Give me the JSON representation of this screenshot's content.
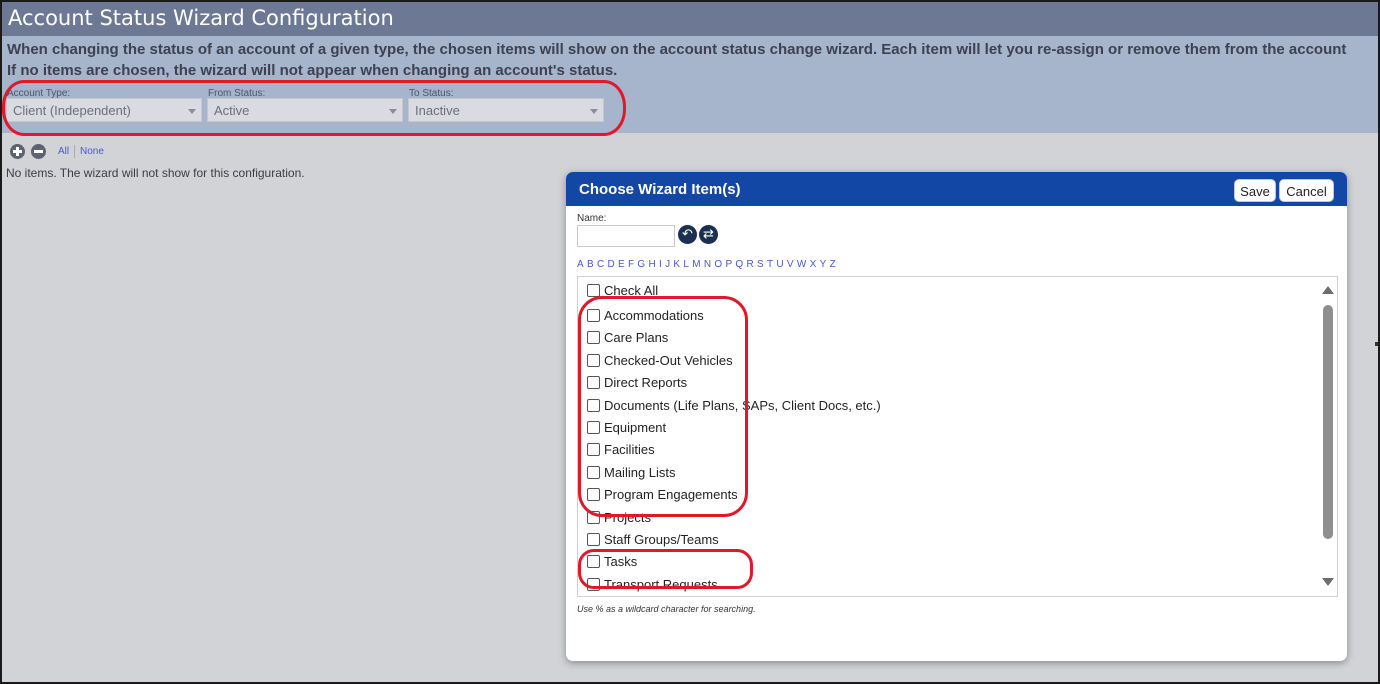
{
  "page": {
    "title": "Account Status Wizard Configuration",
    "description_line1": "When changing the status of an account of a given type, the chosen items will show on the account status change wizard. Each item will let you re-assign or remove them from the account",
    "description_line2": "If no items are chosen, the wizard will not appear when changing an account's status."
  },
  "filters": {
    "account_type": {
      "label": "Account Type:",
      "value": "Client (Independent)"
    },
    "from_status": {
      "label": "From Status:",
      "value": "Active"
    },
    "to_status": {
      "label": "To Status:",
      "value": "Inactive"
    }
  },
  "toolbar": {
    "all_label": "All",
    "none_label": "None"
  },
  "empty_message": "No items. The wizard will not show for this configuration.",
  "modal": {
    "title": "Choose Wizard Item(s)",
    "save_label": "Save",
    "cancel_label": "Cancel",
    "name_label": "Name:",
    "name_value": "",
    "alphabet": [
      "A",
      "B",
      "C",
      "D",
      "E",
      "F",
      "G",
      "H",
      "I",
      "J",
      "K",
      "L",
      "M",
      "N",
      "O",
      "P",
      "Q",
      "R",
      "S",
      "T",
      "U",
      "V",
      "W",
      "X",
      "Y",
      "Z"
    ],
    "check_all_label": "Check All",
    "items": [
      {
        "label": "Accommodations",
        "checked": false
      },
      {
        "label": "Care Plans",
        "checked": false
      },
      {
        "label": "Checked-Out Vehicles",
        "checked": false
      },
      {
        "label": "Direct Reports",
        "checked": false
      },
      {
        "label": "Documents (Life Plans, SAPs, Client Docs, etc.)",
        "checked": false
      },
      {
        "label": "Equipment",
        "checked": false
      },
      {
        "label": "Facilities",
        "checked": false
      },
      {
        "label": "Mailing Lists",
        "checked": false
      },
      {
        "label": "Program Engagements",
        "checked": false
      },
      {
        "label": "Projects",
        "checked": false
      },
      {
        "label": "Staff Groups/Teams",
        "checked": false
      },
      {
        "label": "Tasks",
        "checked": false
      },
      {
        "label": "Transport Requests",
        "checked": false
      }
    ],
    "hint": "Use % as a wildcard character for searching."
  },
  "colors": {
    "title_bar": "#6d7894",
    "description_panel": "#a6b4cc",
    "modal_header": "#1347a6",
    "annotation_red": "#e0192a",
    "link": "#4c59c2"
  }
}
